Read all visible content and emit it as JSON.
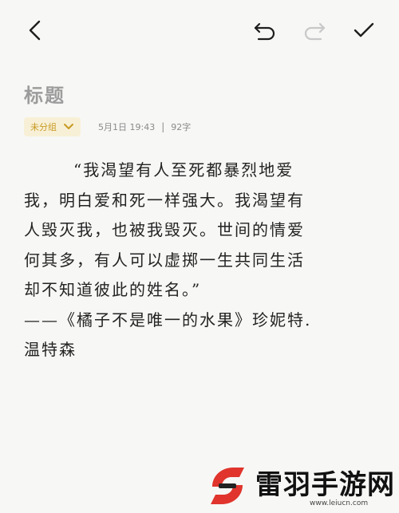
{
  "toolbar": {
    "back_icon": "chevron-left-icon",
    "undo_icon": "undo-icon",
    "redo_icon": "redo-icon",
    "done_icon": "check-icon"
  },
  "note": {
    "title_placeholder": "标题",
    "group_label": "未分组",
    "date": "5月1日 19:43",
    "separator": "|",
    "char_count": "92字",
    "lines": [
      "“我渴望有人至死都暴烈地爱",
      "我，明白爱和死一样强大。我渴望有",
      "人毁灭我，也被我毁灭。世间的情爱",
      "何其多，有人可以虚掷一生共同生活",
      "却不知道彼此的姓名。”",
      "——《橘子不是唯一的水果》珍妮特.",
      "温特森"
    ]
  },
  "watermark": {
    "name": "雷羽手游网",
    "url": "www.leiucn.com"
  },
  "colors": {
    "background": "#f7f7f5",
    "chip_bg": "#f8f0d6",
    "chip_text": "#c79a22",
    "logo_red": "#e0342c",
    "redo_disabled": "#c8c8c8"
  }
}
